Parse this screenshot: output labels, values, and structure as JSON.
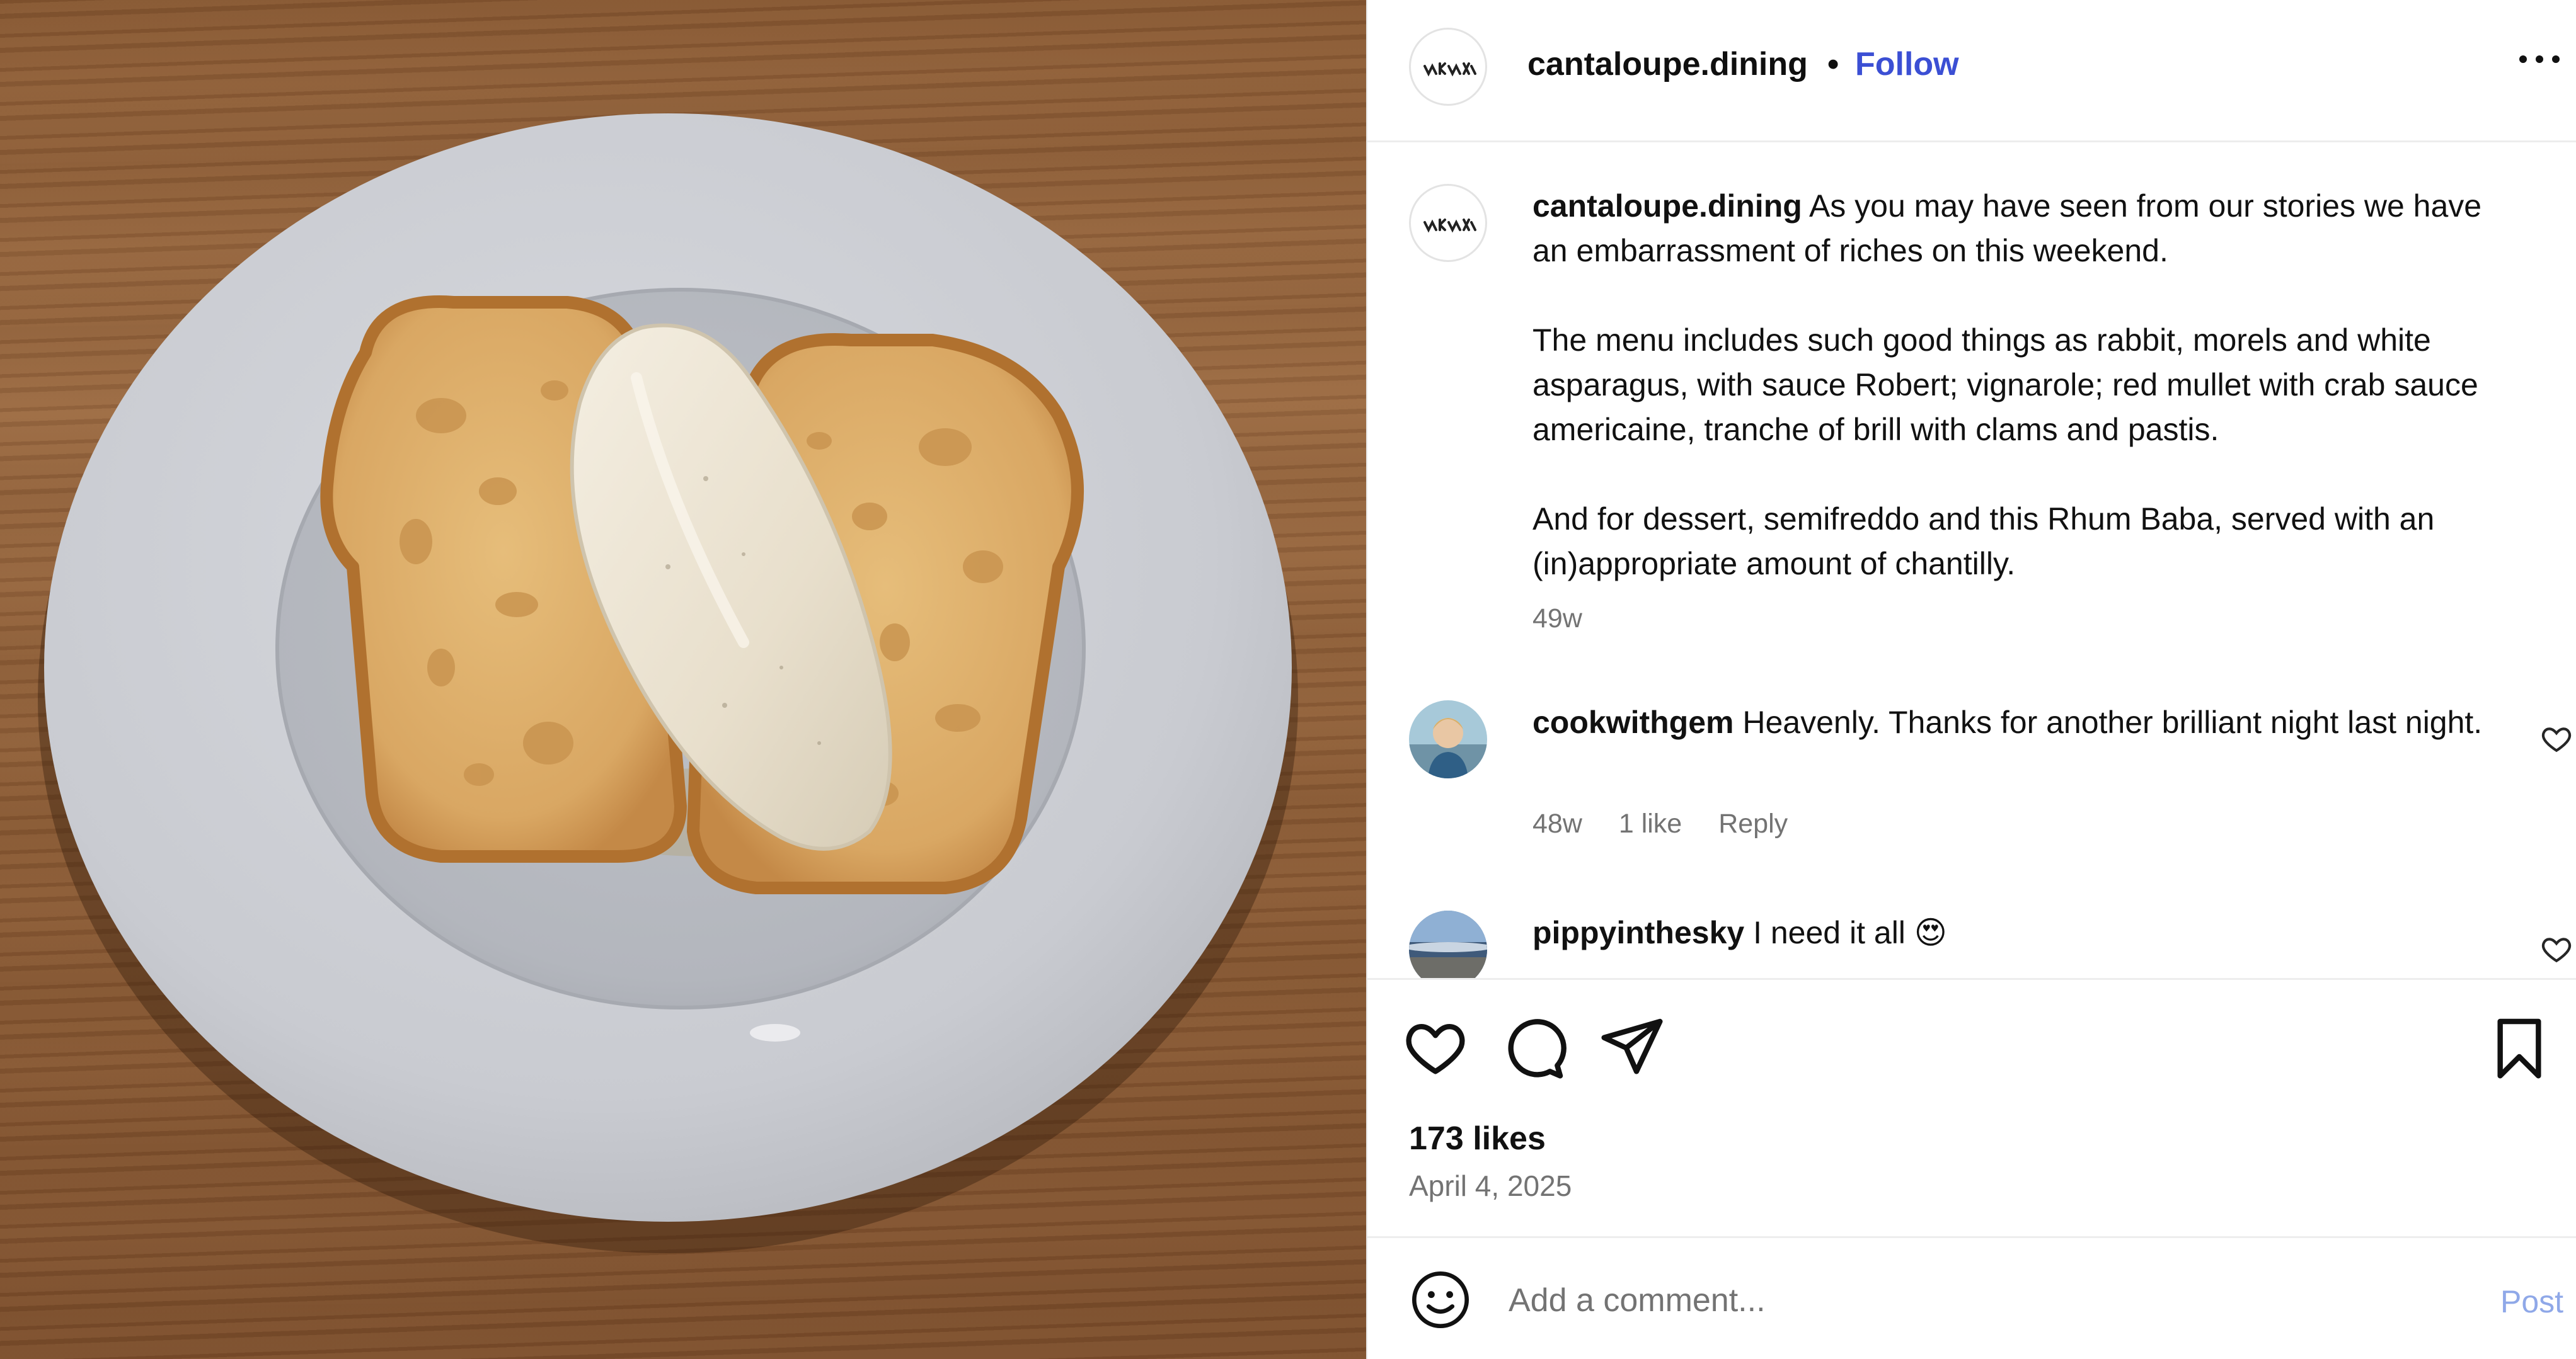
{
  "post": {
    "username": "cantaloupe.dining",
    "separator": "•",
    "follow_label": "Follow",
    "more_icon": "more-horizontal-icon"
  },
  "caption": {
    "username": "cantaloupe.dining",
    "line1": "As you may have seen from our stories we have an embarrassment of riches on this weekend.",
    "line2": "The menu includes such good things as rabbit, morels and white asparagus, with sauce Robert; vignarole; red mullet with crab sauce americaine, tranche of brill with clams and pastis.",
    "line3": "And for dessert, semifreddo and this Rhum Baba, served with an (in)appropriate amount of chantilly.",
    "time": "49w"
  },
  "comments": [
    {
      "username": "cookwithgem",
      "text": "Heavenly. Thanks for another brilliant night last night.",
      "time": "48w",
      "likes": "1 like",
      "reply_label": "Reply"
    },
    {
      "username": "pippyinthesky",
      "text": "I need it all 😍"
    }
  ],
  "actions": {
    "like_icon": "heart-icon",
    "comment_icon": "comment-icon",
    "share_icon": "share-icon",
    "save_icon": "bookmark-icon",
    "likes_count": "173 likes",
    "date": "April 4, 2025"
  },
  "composer": {
    "placeholder": "Add a comment...",
    "post_label": "Post",
    "emoji_icon": "smiley-icon"
  },
  "colors": {
    "link_blue": "#3b4fd4",
    "post_blue_disabled": "#8fa8e8",
    "muted_text": "#737373"
  }
}
